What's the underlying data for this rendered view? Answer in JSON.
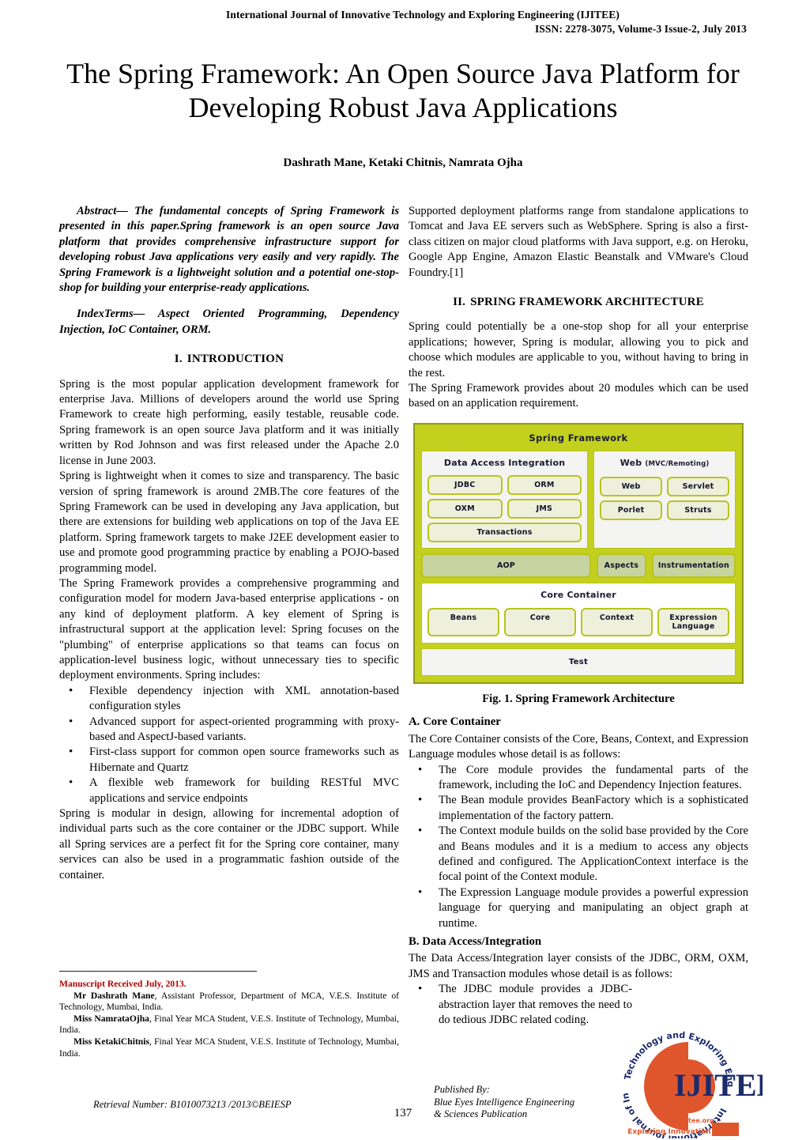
{
  "running_head": {
    "line1": "International Journal of Innovative Technology and Exploring Engineering (IJITEE)",
    "line2": "ISSN: 2278-3075, Volume-3 Issue-2, July 2013"
  },
  "title": "The Spring Framework: An Open Source Java Platform for Developing Robust Java Applications",
  "authors": "Dashrath Mane, Ketaki Chitnis, Namrata Ojha",
  "abstract": "Abstract— The fundamental concepts of Spring Framework is presented in this paper.Spring framework is an open source Java platform that provides comprehensive infrastructure support for developing robust Java applications very easily and very rapidly. The Spring Framework is a lightweight solution and a potential one-stop-shop for building your enterprise-ready applications.",
  "index_terms": "IndexTerms— Aspect Oriented Programming, Dependency Injection, IoC Container, ORM.",
  "sections": {
    "intro": {
      "num": "I.",
      "title": "INTRODUCTION"
    },
    "architecture": {
      "num": "II.",
      "title": "SPRING FRAMEWORK ARCHITECTURE"
    }
  },
  "intro_paragraphs": [
    "Spring is the most popular application development framework for enterprise Java. Millions of developers around the world use Spring Framework to create high performing, easily testable, reusable code. Spring framework is an open source Java platform and it was initially written by Rod Johnson and was first released under the Apache 2.0 license in June 2003.",
    "Spring is lightweight when it comes to size and transparency. The basic version of spring framework is around 2MB.The core features of the Spring Framework can be used in developing any Java application, but there are extensions for building web applications on top of the Java EE platform. Spring framework targets to make J2EE development easier to use and promote good programming practice by enabling a POJO-based programming model.",
    "The Spring Framework provides a comprehensive programming and configuration model for modern Java-based enterprise applications - on any kind of deployment platform. A key element of Spring is infrastructural support at the application level: Spring focuses on the \"plumbing\" of enterprise applications so that teams can focus on application-level business logic, without unnecessary ties to specific deployment environments. Spring includes:"
  ],
  "intro_bullets": [
    "Flexible dependency injection with XML annotation-based configuration styles",
    "Advanced support for aspect-oriented programming with proxy-based and AspectJ-based variants.",
    "First-class support for common open source frameworks such as Hibernate and Quartz",
    "A flexible web framework for building RESTful MVC applications and service endpoints"
  ],
  "intro_closing": "Spring is modular in design, allowing for incremental adoption of individual parts such as the core container or the JDBC support. While all Spring services are a perfect fit for the Spring core container, many services can also be used in a programmatic fashion outside of the container.",
  "right_intro": "Supported deployment platforms range from standalone applications to Tomcat and Java EE servers such as WebSphere. Spring is also a first-class citizen on major cloud platforms with Java support, e.g. on Heroku, Google App Engine, Amazon Elastic Beanstalk and VMware's Cloud Foundry.[1]",
  "arch_paragraphs": [
    "Spring could potentially be a one-stop shop for all your enterprise applications; however, Spring is modular, allowing you to pick and choose which modules are applicable to you, without having to bring in the rest.",
    "The Spring Framework provides about 20 modules which can be used based on an application requirement."
  ],
  "figure": {
    "caption": "Fig. 1.  Spring Framework Architecture",
    "title": "Spring Framework",
    "data_access": {
      "title": "Data Access Integration",
      "modules": [
        "JDBC",
        "ORM",
        "OXM",
        "JMS"
      ],
      "full_module": "Transactions"
    },
    "web": {
      "title": "Web",
      "title_small": "(MVC/Remoting)",
      "modules": [
        "Web",
        "Servlet",
        "Porlet",
        "Struts"
      ]
    },
    "bands": [
      "AOP",
      "Aspects",
      "Instrumentation"
    ],
    "core_container": {
      "title": "Core Container",
      "modules": [
        "Beans",
        "Core",
        "Context",
        "Expression Language"
      ]
    },
    "test": "Test",
    "colors": {
      "background": "#c3d11e",
      "panel": "#f4f4f2",
      "module_fill": "#eff0dc",
      "module_border": "#b9c41c",
      "band_fill": "#c7d3a0",
      "text": "#13132b"
    }
  },
  "subsections": {
    "core_container": {
      "heading": "A. Core Container",
      "lead": "The Core Container consists of the Core, Beans, Context, and Expression Language modules whose detail is as follows:",
      "bullets": [
        "The Core module provides the fundamental parts of the framework, including the IoC and Dependency Injection features.",
        "The Bean module provides BeanFactory which is a sophisticated implementation of the factory pattern.",
        "The Context module builds on the solid base provided by the Core and Beans modules and it is a medium to access any objects defined and configured. The ApplicationContext interface is the focal point of the Context module.",
        "The Expression Language module provides a powerful expression language for querying and manipulating an object graph at runtime."
      ]
    },
    "data_access": {
      "heading": "B. Data Access/Integration",
      "lead": "The Data Access/Integration layer consists of the JDBC, ORM, OXM, JMS and Transaction modules whose detail is as follows:",
      "bullets": [
        "The JDBC module provides a JDBC-abstraction layer that removes the need to do tedious JDBC related coding."
      ]
    }
  },
  "footnote": {
    "heading": "Manuscript Received July, 2013.",
    "entries": [
      {
        "name": "Mr Dashrath Mane",
        "rest": ", Assistant Professor, Department of MCA, V.E.S. Institute of Technology, Mumbai, India."
      },
      {
        "name": "Miss NamrataOjha",
        "rest": ", Final Year MCA Student, V.E.S. Institute of Technology, Mumbai, India."
      },
      {
        "name": "Miss KetakiChitnis",
        "rest": ", Final Year MCA Student, V.E.S. Institute of Technology, Mumbai, India."
      }
    ]
  },
  "footer": {
    "retrieval": "Retrieval Number: B1010073213 /2013©BEIESP",
    "page_number": "137",
    "published_by": "Published By:",
    "publisher_line1": "Blue Eyes Intelligence Engineering",
    "publisher_line2": "& Sciences Publication"
  },
  "logo": {
    "acronym": "IJITEE",
    "arc_top": "Technology and Exploring Engineering",
    "arc_bottom": "International Journal of Innovative",
    "url": "www.ijitee.org",
    "tagline": "Exploring Innovation",
    "orange": "#e0562c",
    "navy": "#1a2a6c"
  }
}
